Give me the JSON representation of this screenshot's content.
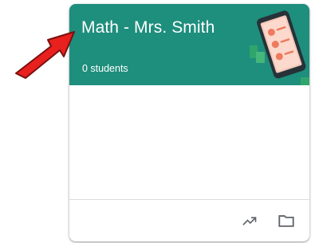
{
  "card": {
    "title": "Math - Mrs. Smith",
    "subtitle": "0 students",
    "header_color": "#1e8e7d"
  },
  "actions": {
    "trend_icon": "trending-up-icon",
    "folder_icon": "folder-icon"
  },
  "annotation": {
    "arrow_color": "#e8201e",
    "arrow_icon": "red-arrow-annotation"
  }
}
